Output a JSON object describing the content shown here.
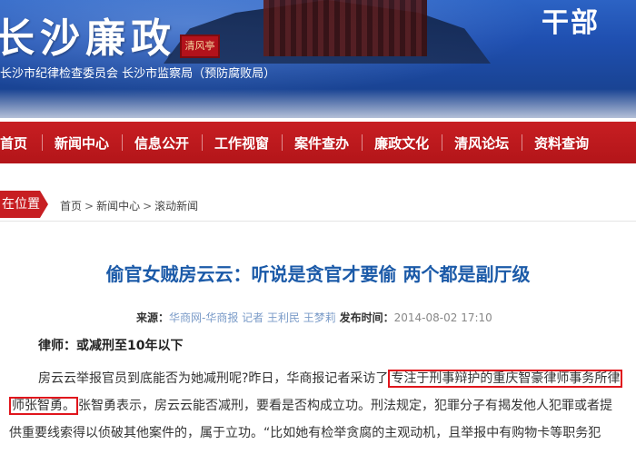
{
  "banner": {
    "site_title": "长沙廉政",
    "subtitle": "长沙市纪律检查委员会    长沙市监察局（预防腐败局）",
    "corner_text": "干部",
    "plaque_text": "清风亭"
  },
  "nav": {
    "items": [
      {
        "label": "首页"
      },
      {
        "label": "新闻中心"
      },
      {
        "label": "信息公开"
      },
      {
        "label": "工作视窗"
      },
      {
        "label": "案件查办"
      },
      {
        "label": "廉政文化"
      },
      {
        "label": "清风论坛"
      },
      {
        "label": "资料查询"
      }
    ]
  },
  "breadcrumb": {
    "position_label": "在位置",
    "items": [
      "首页",
      "新闻中心",
      "滚动新闻"
    ],
    "separator": ">"
  },
  "article": {
    "title": "偷官女贼房云云：听说是贪官才要偷  两个都是副厅级",
    "meta": {
      "source_label": "来源：",
      "source": "华商网-华商报 记者 王利民 王梦莉",
      "published_label": "发布时间：",
      "published": "2014-08-02 17:10"
    },
    "subheading": "律师：或减刑至10年以下",
    "paragraph_lines": [
      {
        "before": "房云云举报官员到底能否为她减刑呢?昨日，华商报记者采访了",
        "highlight": "专注于刑事辩护的重庆智豪律师事务所律",
        "after": ""
      },
      {
        "before": "",
        "highlight": "师张智勇。",
        "after": "张智勇表示，房云云能否减刑，要看是否构成立功。刑法规定，犯罪分子有揭发他人犯罪或者提"
      },
      {
        "before": "供重要线索得以侦破其他案件的，属于立功。“比如她有检举贪腐的主观动机，且举报中有购物卡等职务犯",
        "highlight": "",
        "after": ""
      }
    ]
  },
  "colors": {
    "nav_red": "#c71e22",
    "title_blue": "#1b5aa8",
    "highlight_border": "#e0151c"
  }
}
